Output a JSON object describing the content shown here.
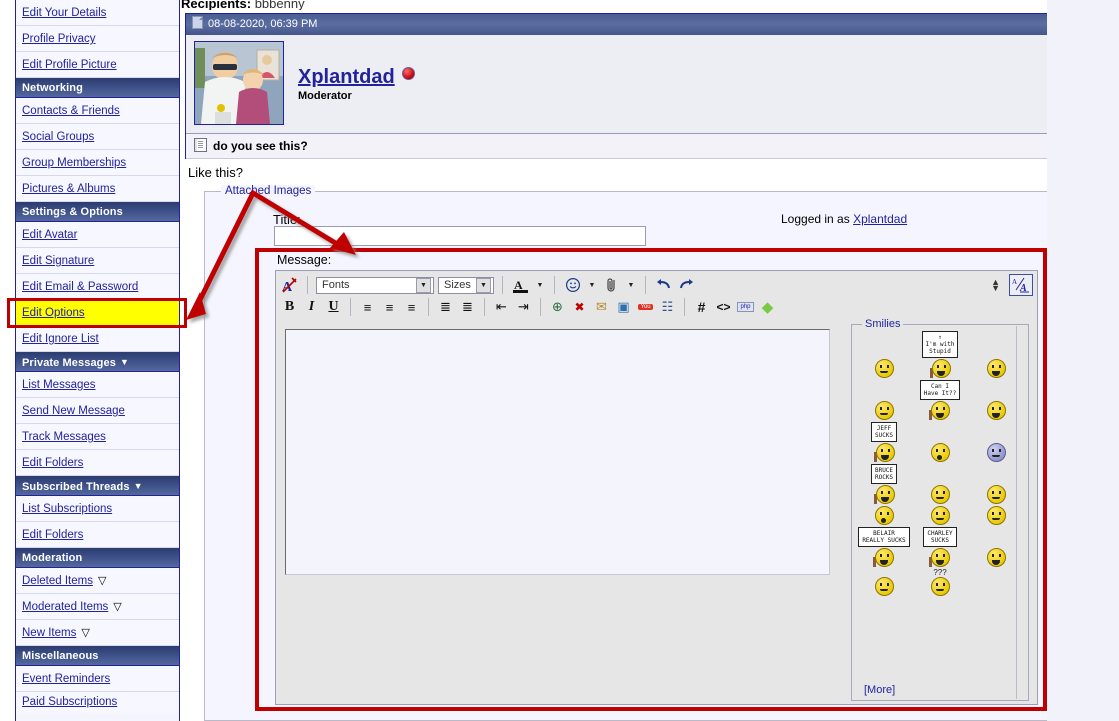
{
  "sidebar": {
    "items": [
      {
        "type": "item",
        "label": "Edit Your Details",
        "name": "edit-your-details"
      },
      {
        "type": "item",
        "label": "Profile Privacy",
        "name": "profile-privacy"
      },
      {
        "type": "item",
        "label": "Edit Profile Picture",
        "name": "edit-profile-picture"
      },
      {
        "type": "head",
        "label": "Networking",
        "name": "networking",
        "caret": ""
      },
      {
        "type": "item",
        "label": "Contacts & Friends",
        "name": "contacts-friends"
      },
      {
        "type": "item",
        "label": "Social Groups",
        "name": "social-groups"
      },
      {
        "type": "item",
        "label": "Group Memberships",
        "name": "group-memberships"
      },
      {
        "type": "item",
        "label": "Pictures & Albums",
        "name": "pictures-albums"
      },
      {
        "type": "head",
        "label": "Settings & Options",
        "name": "settings-options",
        "caret": ""
      },
      {
        "type": "item",
        "label": "Edit Avatar",
        "name": "edit-avatar"
      },
      {
        "type": "item",
        "label": "Edit Signature",
        "name": "edit-signature"
      },
      {
        "type": "item",
        "label": "Edit Email & Password",
        "name": "edit-email-password"
      },
      {
        "type": "item",
        "label": "Edit Options",
        "name": "edit-options",
        "highlight": true
      },
      {
        "type": "item",
        "label": "Edit Ignore List",
        "name": "edit-ignore-list"
      },
      {
        "type": "head",
        "label": "Private Messages",
        "name": "private-messages",
        "caret": "▼"
      },
      {
        "type": "item",
        "label": "List Messages",
        "name": "list-messages"
      },
      {
        "type": "item",
        "label": "Send New Message",
        "name": "send-new-message"
      },
      {
        "type": "item",
        "label": "Track Messages",
        "name": "track-messages"
      },
      {
        "type": "item",
        "label": "Edit Folders",
        "name": "edit-folders-pm"
      },
      {
        "type": "head",
        "label": "Subscribed Threads",
        "name": "subscribed-threads",
        "caret": "▼"
      },
      {
        "type": "item",
        "label": "List Subscriptions",
        "name": "list-subscriptions"
      },
      {
        "type": "item",
        "label": "Edit Folders",
        "name": "edit-folders-subs"
      },
      {
        "type": "head",
        "label": "Moderation",
        "name": "moderation",
        "caret": ""
      },
      {
        "type": "item",
        "label": "Deleted Items",
        "name": "deleted-items",
        "flag": "▽"
      },
      {
        "type": "item",
        "label": "Moderated Items",
        "name": "moderated-items",
        "flag": "▽"
      },
      {
        "type": "item",
        "label": "New Items",
        "name": "new-items",
        "flag": "▽"
      },
      {
        "type": "head",
        "label": "Miscellaneous",
        "name": "miscellaneous",
        "caret": ""
      },
      {
        "type": "item",
        "label": "Event Reminders",
        "name": "event-reminders"
      },
      {
        "type": "partial",
        "label": "Paid Subscriptions",
        "name": "paid-subscriptions"
      }
    ]
  },
  "post": {
    "recipients_label": "Recipients",
    "recipients_value": "bbbenny",
    "date": "08-08-2020, 06:39 PM",
    "username": "Xplantdad",
    "usertitle": "Moderator",
    "subject": "do you see this?",
    "body_text": "Like this?"
  },
  "form": {
    "attached_images_legend": "Attached Images",
    "title_label": "Title:",
    "title_value": "",
    "logged_in_prefix": "Logged in as",
    "logged_in_user": "Xplantdad",
    "message_label": "Message:",
    "message_value": ""
  },
  "toolbar": {
    "remove_format_icon": "remove-format-icon",
    "fonts_placeholder": "Fonts",
    "sizes_placeholder": "Sizes",
    "font_color_icon": "font-color-icon",
    "smilie_icon": "smilie-icon",
    "attach_icon": "paperclip-icon",
    "undo_icon": "↶",
    "redo_icon": "↷",
    "row2": [
      {
        "name": "bold-button",
        "glyph": "B"
      },
      {
        "name": "italic-button",
        "glyph": "I"
      },
      {
        "name": "underline-button",
        "glyph": "U"
      },
      {
        "name": "align-left-button",
        "glyph": "≡"
      },
      {
        "name": "align-center-button",
        "glyph": "≡"
      },
      {
        "name": "align-right-button",
        "glyph": "≡"
      },
      {
        "name": "ordered-list-button",
        "glyph": "≣"
      },
      {
        "name": "unordered-list-button",
        "glyph": "≣"
      },
      {
        "name": "outdent-button",
        "glyph": "⇤"
      },
      {
        "name": "indent-button",
        "glyph": "⇥"
      },
      {
        "name": "insert-link-button",
        "glyph": "⊕"
      },
      {
        "name": "unlink-button",
        "glyph": "✖"
      },
      {
        "name": "insert-email-button",
        "glyph": "✉"
      },
      {
        "name": "insert-image-button",
        "glyph": "▣"
      },
      {
        "name": "youtube-button",
        "glyph": "You"
      },
      {
        "name": "quote-button",
        "glyph": "☷"
      },
      {
        "name": "hash-button",
        "glyph": "#"
      },
      {
        "name": "code-button",
        "glyph": "<>"
      },
      {
        "name": "php-button",
        "glyph": "php"
      },
      {
        "name": "video-button",
        "glyph": "◆"
      }
    ],
    "resize_icon": "resize-handle-icon",
    "wysiwyg_toggle_icon": "toggle-editor-mode-icon"
  },
  "smilies": {
    "legend": "Smilies",
    "more_label": "[More]",
    "rows": [
      [
        {
          "kind": "face",
          "name": "smilie-confused",
          "mouth": "flat"
        },
        {
          "kind": "sign",
          "name": "smilie-im-with-stupid",
          "text": "↑\nI'm with\nStupid"
        },
        {
          "kind": "face",
          "name": "smilie-cool",
          "mouth": "big"
        }
      ],
      [
        {
          "kind": "face",
          "name": "smilie-bow",
          "mouth": "flat"
        },
        {
          "kind": "sign",
          "name": "smilie-can-i-have-it",
          "text": "Can I\nHave It??"
        },
        {
          "kind": "face",
          "name": "smilie-grin",
          "mouth": "big"
        }
      ],
      [
        {
          "kind": "sign",
          "name": "smilie-jeff-sucks",
          "text": "JEFF\nSUCKS"
        },
        {
          "kind": "face",
          "name": "smilie-shocked",
          "mouth": "o"
        },
        {
          "kind": "face",
          "name": "smilie-bored",
          "mouth": "flat",
          "color": "blue"
        }
      ],
      [
        {
          "kind": "sign",
          "name": "smilie-bruce-rocks",
          "text": "BRUCE\nROCKS"
        },
        {
          "kind": "face",
          "name": "smilie-hug",
          "mouth": "flat"
        },
        {
          "kind": "face",
          "name": "smilie-wave",
          "mouth": "flat"
        }
      ],
      [
        {
          "kind": "face",
          "name": "smilie-surprised",
          "mouth": "o"
        },
        {
          "kind": "face",
          "name": "smilie-thumbsup",
          "mouth": "flat"
        },
        {
          "kind": "face",
          "name": "smilie-frown",
          "mouth": "flat"
        }
      ],
      [
        {
          "kind": "sign",
          "name": "smilie-belair-really-sucks",
          "text": "BELAIR\nREALLY SUCKS"
        },
        {
          "kind": "sign",
          "name": "smilie-charley-sucks",
          "text": "CHARLEY\nSUCKS"
        },
        {
          "kind": "face",
          "name": "smilie-teeth",
          "mouth": "big"
        }
      ],
      [
        {
          "kind": "face",
          "name": "smilie-wink",
          "mouth": "flat"
        },
        {
          "kind": "face",
          "name": "smilie-confused-question",
          "mouth": "flat",
          "sup": "???"
        },
        {
          "kind": "blank",
          "name": "smilie-blank"
        }
      ]
    ]
  },
  "annotation": {
    "accent_color": "#C00000",
    "highlight_color": "#FFFF00"
  }
}
